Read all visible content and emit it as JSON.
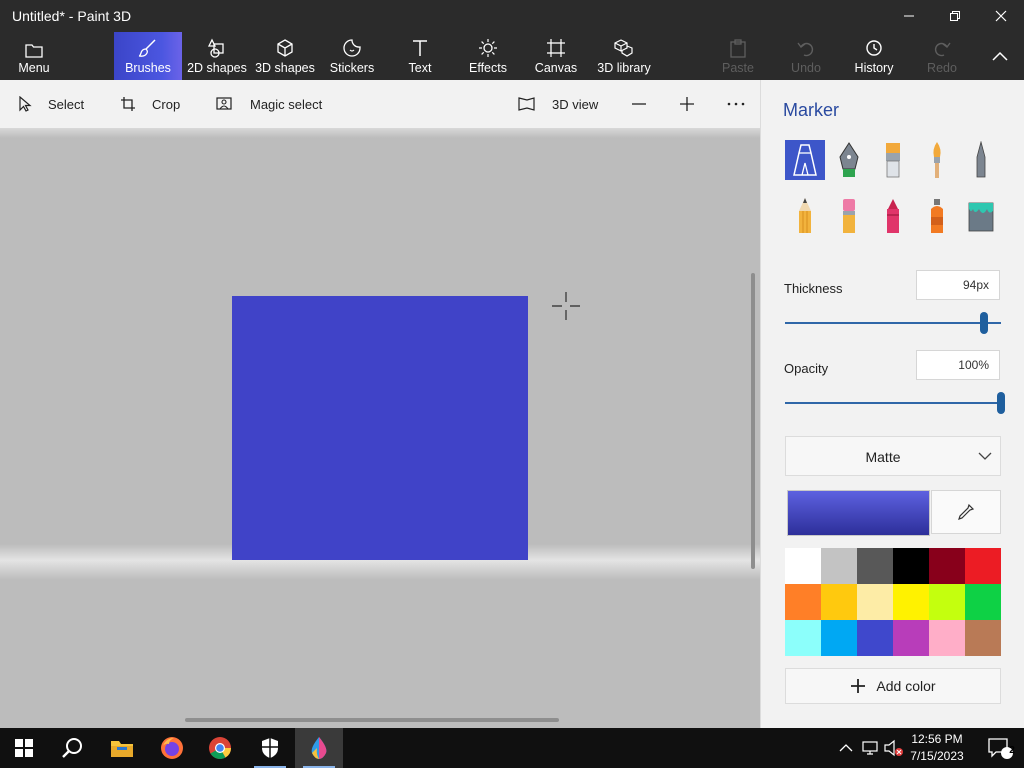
{
  "window": {
    "title": "Untitled* - Paint 3D"
  },
  "ribbon": {
    "menu": "Menu",
    "tabs": [
      {
        "label": "Brushes",
        "icon": "brush-icon",
        "active": true
      },
      {
        "label": "2D shapes",
        "icon": "2d-shapes-icon"
      },
      {
        "label": "3D shapes",
        "icon": "3d-shapes-icon"
      },
      {
        "label": "Stickers",
        "icon": "stickers-icon"
      },
      {
        "label": "Text",
        "icon": "text-icon"
      },
      {
        "label": "Effects",
        "icon": "effects-icon"
      },
      {
        "label": "Canvas",
        "icon": "canvas-icon"
      },
      {
        "label": "3D library",
        "icon": "3d-library-icon"
      }
    ],
    "actions": [
      {
        "label": "Paste",
        "icon": "paste-icon",
        "enabled": false
      },
      {
        "label": "Undo",
        "icon": "undo-icon",
        "enabled": false
      },
      {
        "label": "History",
        "icon": "history-icon",
        "enabled": true
      },
      {
        "label": "Redo",
        "icon": "redo-icon",
        "enabled": false
      }
    ]
  },
  "toolbar": {
    "select": "Select",
    "crop": "Crop",
    "magic_select": "Magic select",
    "view_3d": "3D view"
  },
  "canvas": {
    "fill_color": "#4043c8",
    "background": "#bcbcbc"
  },
  "panel": {
    "title": "Marker",
    "brushes": [
      "marker",
      "calligraphy-pen",
      "oil-brush",
      "watercolor",
      "pixel-pen",
      "pencil",
      "eraser",
      "crayon",
      "spray-can",
      "fill"
    ],
    "selected_brush": "marker",
    "thickness_label": "Thickness",
    "thickness_value": "94",
    "thickness_unit": "px",
    "thickness_fraction": 0.92,
    "opacity_label": "Opacity",
    "opacity_value": "100%",
    "opacity_fraction": 1.0,
    "material": "Matte",
    "current_color": "#4043c8",
    "palette": [
      "#ffffff",
      "#c3c3c3",
      "#585858",
      "#000000",
      "#88001b",
      "#ec1c24",
      "#ff7f27",
      "#ffc90e",
      "#fdeca6",
      "#fff200",
      "#c4ff0e",
      "#0ed145",
      "#8cfffb",
      "#00a8f3",
      "#3f48cc",
      "#b83dba",
      "#ffaec8",
      "#b97a56"
    ],
    "add_color": "Add color"
  },
  "taskbar": {
    "apps": [
      "windows-start",
      "search",
      "file-explorer",
      "firefox",
      "chrome",
      "windows-security",
      "paint-3d"
    ],
    "time": "12:56 PM",
    "date": "7/15/2023",
    "notifications": "2"
  }
}
